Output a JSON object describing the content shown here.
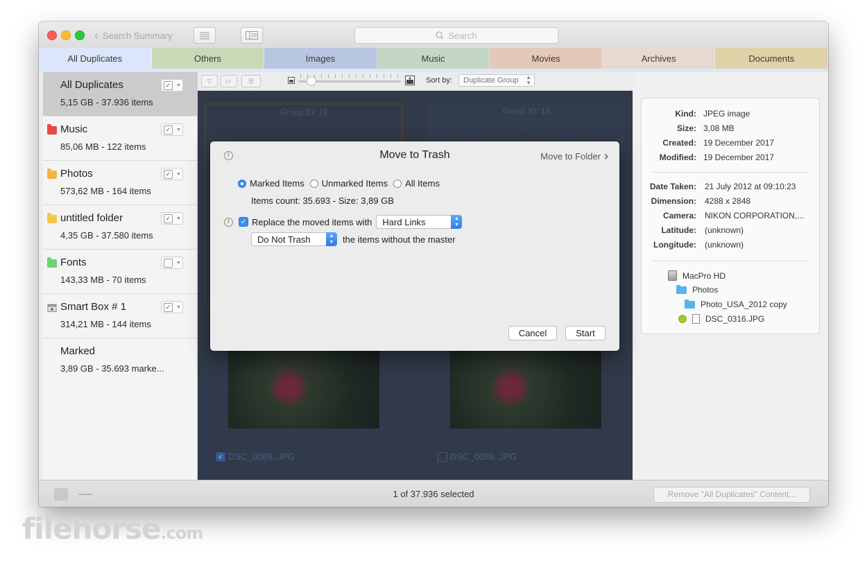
{
  "titlebar": {
    "back_label": "Search Summary",
    "search_placeholder": "Search"
  },
  "tabs": [
    {
      "label": "All Duplicates",
      "color": "#dce6fb"
    },
    {
      "label": "Others",
      "color": "#c9d9b7"
    },
    {
      "label": "Images",
      "color": "#b8c6e2"
    },
    {
      "label": "Music",
      "color": "#c4d6c4"
    },
    {
      "label": "Movies",
      "color": "#e4c9b8"
    },
    {
      "label": "Archives",
      "color": "#e6d9cf"
    },
    {
      "label": "Documents",
      "color": "#dfd2a7"
    }
  ],
  "sidebar": {
    "items": [
      {
        "title": "All Duplicates",
        "sub": "5,15 GB - 37.936 items",
        "checked": true,
        "icon": "none"
      },
      {
        "title": "Music",
        "sub": "85,06 MB - 122 items",
        "checked": true,
        "icon": "red-folder-icon",
        "color": "#e8474b"
      },
      {
        "title": "Photos",
        "sub": "573,62 MB - 164 items",
        "checked": true,
        "icon": "orange-folder-icon",
        "color": "#f2b447"
      },
      {
        "title": "untitled folder",
        "sub": "4,35 GB - 37.580 items",
        "checked": true,
        "icon": "yellow-folder-icon",
        "color": "#f4c64a"
      },
      {
        "title": "Fonts",
        "sub": "143,33 MB - 70 items",
        "checked": false,
        "icon": "green-folder-icon",
        "color": "#6ed36e"
      },
      {
        "title": "Smart Box # 1",
        "sub": "314,21 MB - 144 items",
        "checked": true,
        "icon": "smart-box-icon"
      },
      {
        "title": "Marked",
        "sub": "3,89 GB - 35.693 marke...",
        "icon": "none"
      }
    ]
  },
  "content_toolbar": {
    "sort_label": "Sort by:",
    "sort_value": "Duplicate Group"
  },
  "grid": {
    "cards": [
      {
        "group": "Group ID: 19",
        "filename": "DSC_0089..JPG",
        "checked": true
      },
      {
        "group": "Group ID: 19",
        "filename": "DSC_0089..JPG",
        "checked": false
      }
    ]
  },
  "info": {
    "kind_label": "Kind:",
    "kind": "JPEG image",
    "size_label": "Size:",
    "size": "3,08 MB",
    "created_label": "Created:",
    "created": "19 December 2017",
    "modified_label": "Modified:",
    "modified": "19 December 2017",
    "date_taken_label": "Date Taken:",
    "date_taken": "21 July 2012 at 09:10:23",
    "dimension_label": "Dimension:",
    "dimension": "4288 x 2848",
    "camera_label": "Camera:",
    "camera": "NIKON CORPORATION,...",
    "latitude_label": "Latitude:",
    "latitude": "(unknown)",
    "longitude_label": "Longitude:",
    "longitude": "(unknown)",
    "path": [
      "MacPro HD",
      "Photos",
      "Photo_USA_2012 copy",
      "DSC_0316.JPG"
    ]
  },
  "bottombar": {
    "status": "1 of 37.936 selected",
    "remove_label": "Remove \"All Duplicates\" Content..."
  },
  "dialog": {
    "title": "Move to Trash",
    "move_to_folder": "Move to Folder",
    "radio_marked": "Marked Items",
    "radio_unmarked": "Unmarked Items",
    "radio_all": "All Items",
    "count_line": "Items count: 35.693 - Size: 3,89 GB",
    "replace_label": "Replace the moved items with",
    "replace_value": "Hard Links",
    "trash_value": "Do Not Trash",
    "trash_suffix": "the items without the master",
    "cancel_label": "Cancel",
    "start_label": "Start"
  },
  "watermark": {
    "text": "filehorse",
    "suffix": ".com"
  }
}
